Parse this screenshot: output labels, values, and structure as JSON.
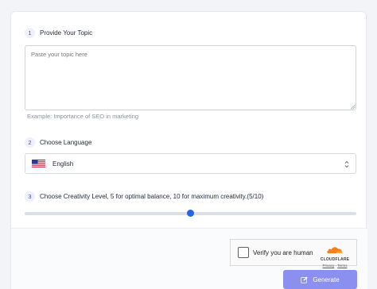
{
  "steps": [
    {
      "num": "1",
      "label": "Provide Your Topic"
    },
    {
      "num": "2",
      "label": "Choose Language"
    },
    {
      "num": "3",
      "label": "Choose Creativity Level, 5 for optimal balance, 10 for maximum creativity.(5/10)"
    }
  ],
  "topic": {
    "placeholder": "Paste your topic here",
    "value": "",
    "example": "Example:  Importance of SEO in marketing"
  },
  "language": {
    "selected": "English",
    "flag_icon": "us-flag-icon"
  },
  "creativity": {
    "value": 5,
    "min": 0,
    "max": 10,
    "accent": "#2563eb"
  },
  "captcha": {
    "label": "Verify you are human",
    "brand": "CLOUDFLARE",
    "privacy": "Privacy",
    "separator": "·",
    "terms": "Terms"
  },
  "generate": {
    "label": "Generate",
    "color": "#8b8ff0"
  }
}
